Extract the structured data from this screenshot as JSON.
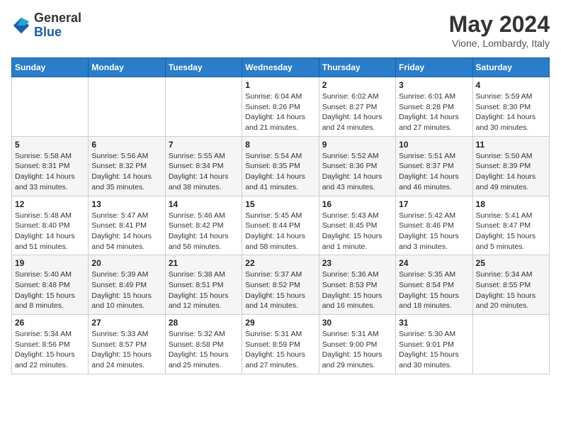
{
  "header": {
    "logo_general": "General",
    "logo_blue": "Blue",
    "month_title": "May 2024",
    "location": "Vione, Lombardy, Italy"
  },
  "days_of_week": [
    "Sunday",
    "Monday",
    "Tuesday",
    "Wednesday",
    "Thursday",
    "Friday",
    "Saturday"
  ],
  "weeks": [
    [
      {
        "day": "",
        "info": ""
      },
      {
        "day": "",
        "info": ""
      },
      {
        "day": "",
        "info": ""
      },
      {
        "day": "1",
        "info": "Sunrise: 6:04 AM\nSunset: 8:26 PM\nDaylight: 14 hours\nand 21 minutes."
      },
      {
        "day": "2",
        "info": "Sunrise: 6:02 AM\nSunset: 8:27 PM\nDaylight: 14 hours\nand 24 minutes."
      },
      {
        "day": "3",
        "info": "Sunrise: 6:01 AM\nSunset: 8:28 PM\nDaylight: 14 hours\nand 27 minutes."
      },
      {
        "day": "4",
        "info": "Sunrise: 5:59 AM\nSunset: 8:30 PM\nDaylight: 14 hours\nand 30 minutes."
      }
    ],
    [
      {
        "day": "5",
        "info": "Sunrise: 5:58 AM\nSunset: 8:31 PM\nDaylight: 14 hours\nand 33 minutes."
      },
      {
        "day": "6",
        "info": "Sunrise: 5:56 AM\nSunset: 8:32 PM\nDaylight: 14 hours\nand 35 minutes."
      },
      {
        "day": "7",
        "info": "Sunrise: 5:55 AM\nSunset: 8:34 PM\nDaylight: 14 hours\nand 38 minutes."
      },
      {
        "day": "8",
        "info": "Sunrise: 5:54 AM\nSunset: 8:35 PM\nDaylight: 14 hours\nand 41 minutes."
      },
      {
        "day": "9",
        "info": "Sunrise: 5:52 AM\nSunset: 8:36 PM\nDaylight: 14 hours\nand 43 minutes."
      },
      {
        "day": "10",
        "info": "Sunrise: 5:51 AM\nSunset: 8:37 PM\nDaylight: 14 hours\nand 46 minutes."
      },
      {
        "day": "11",
        "info": "Sunrise: 5:50 AM\nSunset: 8:39 PM\nDaylight: 14 hours\nand 49 minutes."
      }
    ],
    [
      {
        "day": "12",
        "info": "Sunrise: 5:48 AM\nSunset: 8:40 PM\nDaylight: 14 hours\nand 51 minutes."
      },
      {
        "day": "13",
        "info": "Sunrise: 5:47 AM\nSunset: 8:41 PM\nDaylight: 14 hours\nand 54 minutes."
      },
      {
        "day": "14",
        "info": "Sunrise: 5:46 AM\nSunset: 8:42 PM\nDaylight: 14 hours\nand 56 minutes."
      },
      {
        "day": "15",
        "info": "Sunrise: 5:45 AM\nSunset: 8:44 PM\nDaylight: 14 hours\nand 58 minutes."
      },
      {
        "day": "16",
        "info": "Sunrise: 5:43 AM\nSunset: 8:45 PM\nDaylight: 15 hours\nand 1 minute."
      },
      {
        "day": "17",
        "info": "Sunrise: 5:42 AM\nSunset: 8:46 PM\nDaylight: 15 hours\nand 3 minutes."
      },
      {
        "day": "18",
        "info": "Sunrise: 5:41 AM\nSunset: 8:47 PM\nDaylight: 15 hours\nand 5 minutes."
      }
    ],
    [
      {
        "day": "19",
        "info": "Sunrise: 5:40 AM\nSunset: 8:48 PM\nDaylight: 15 hours\nand 8 minutes."
      },
      {
        "day": "20",
        "info": "Sunrise: 5:39 AM\nSunset: 8:49 PM\nDaylight: 15 hours\nand 10 minutes."
      },
      {
        "day": "21",
        "info": "Sunrise: 5:38 AM\nSunset: 8:51 PM\nDaylight: 15 hours\nand 12 minutes."
      },
      {
        "day": "22",
        "info": "Sunrise: 5:37 AM\nSunset: 8:52 PM\nDaylight: 15 hours\nand 14 minutes."
      },
      {
        "day": "23",
        "info": "Sunrise: 5:36 AM\nSunset: 8:53 PM\nDaylight: 15 hours\nand 16 minutes."
      },
      {
        "day": "24",
        "info": "Sunrise: 5:35 AM\nSunset: 8:54 PM\nDaylight: 15 hours\nand 18 minutes."
      },
      {
        "day": "25",
        "info": "Sunrise: 5:34 AM\nSunset: 8:55 PM\nDaylight: 15 hours\nand 20 minutes."
      }
    ],
    [
      {
        "day": "26",
        "info": "Sunrise: 5:34 AM\nSunset: 8:56 PM\nDaylight: 15 hours\nand 22 minutes."
      },
      {
        "day": "27",
        "info": "Sunrise: 5:33 AM\nSunset: 8:57 PM\nDaylight: 15 hours\nand 24 minutes."
      },
      {
        "day": "28",
        "info": "Sunrise: 5:32 AM\nSunset: 8:58 PM\nDaylight: 15 hours\nand 25 minutes."
      },
      {
        "day": "29",
        "info": "Sunrise: 5:31 AM\nSunset: 8:59 PM\nDaylight: 15 hours\nand 27 minutes."
      },
      {
        "day": "30",
        "info": "Sunrise: 5:31 AM\nSunset: 9:00 PM\nDaylight: 15 hours\nand 29 minutes."
      },
      {
        "day": "31",
        "info": "Sunrise: 5:30 AM\nSunset: 9:01 PM\nDaylight: 15 hours\nand 30 minutes."
      },
      {
        "day": "",
        "info": ""
      }
    ]
  ]
}
